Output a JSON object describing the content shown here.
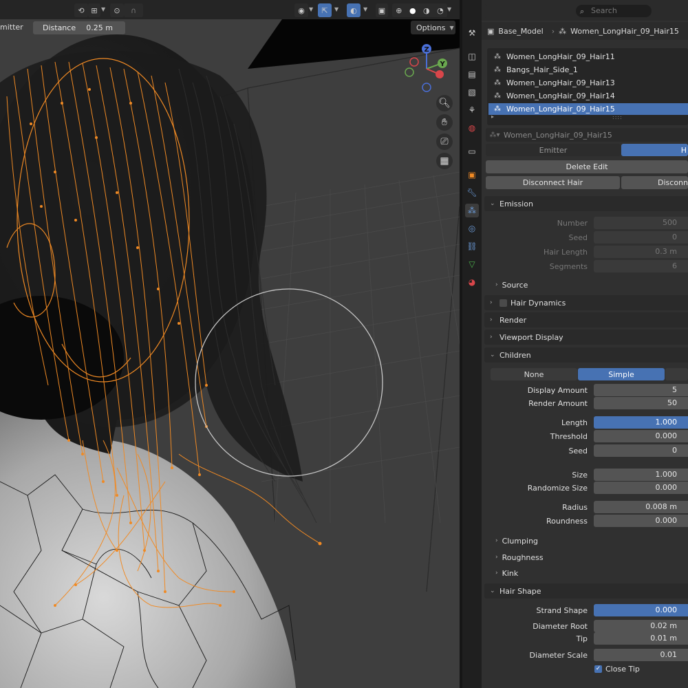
{
  "viewport": {
    "header_mode_label": "mitter",
    "distance_label": "Distance",
    "distance_value": "0.25 m",
    "options_label": "Options",
    "gizmo": {
      "z": "Z",
      "y": "Y"
    }
  },
  "panel": {
    "search_placeholder": "Search",
    "breadcrumb": {
      "object": "Base_Model",
      "system": "Women_LongHair_09_Hair15"
    },
    "particle_systems": [
      {
        "name": "Women_LongHair_09_Hair11",
        "selected": false
      },
      {
        "name": "Bangs_Hair_Side_1",
        "selected": false
      },
      {
        "name": "Women_LongHair_09_Hair13",
        "selected": false
      },
      {
        "name": "Women_LongHair_09_Hair14",
        "selected": false
      },
      {
        "name": "Women_LongHair_09_Hair15",
        "selected": true
      }
    ],
    "settings_name": "Women_LongHair_09_Hair15",
    "type_tabs": {
      "emitter": "Emitter",
      "hair": "H"
    },
    "delete_edit": "Delete Edit",
    "disconnect_hair": "Disconnect Hair",
    "disconnect_all": "Disconn",
    "emission": {
      "title": "Emission",
      "number_label": "Number",
      "number": "500",
      "seed_label": "Seed",
      "seed": "0",
      "hair_length_label": "Hair Length",
      "hair_length": "0.3 m",
      "segments_label": "Segments",
      "segments": "6",
      "source": "Source"
    },
    "hair_dynamics": "Hair Dynamics",
    "render": "Render",
    "viewport_display": "Viewport Display",
    "children": {
      "title": "Children",
      "none": "None",
      "simple": "Simple",
      "display_amount_label": "Display Amount",
      "display_amount": "5",
      "render_amount_label": "Render Amount",
      "render_amount": "50",
      "length_label": "Length",
      "length": "1.000",
      "threshold_label": "Threshold",
      "threshold": "0.000",
      "seed_label": "Seed",
      "seed": "0",
      "size_label": "Size",
      "size": "1.000",
      "randomize_size_label": "Randomize Size",
      "randomize_size": "0.000",
      "radius_label": "Radius",
      "radius": "0.008 m",
      "roundness_label": "Roundness",
      "roundness": "0.000",
      "clumping": "Clumping",
      "roughness": "Roughness",
      "kink": "Kink"
    },
    "hair_shape": {
      "title": "Hair Shape",
      "strand_shape_label": "Strand Shape",
      "strand_shape": "0.000",
      "diameter_root_label": "Diameter Root",
      "diameter_root": "0.02 m",
      "tip_label": "Tip",
      "tip": "0.01 m",
      "diameter_scale_label": "Diameter Scale",
      "diameter_scale": "0.01",
      "close_tip": "Close Tip"
    }
  },
  "colors": {
    "accent": "#4772b3",
    "hair_guides": "#f08a24",
    "panel_bg": "#303030",
    "viewport_bg": "#3d3d3d"
  }
}
